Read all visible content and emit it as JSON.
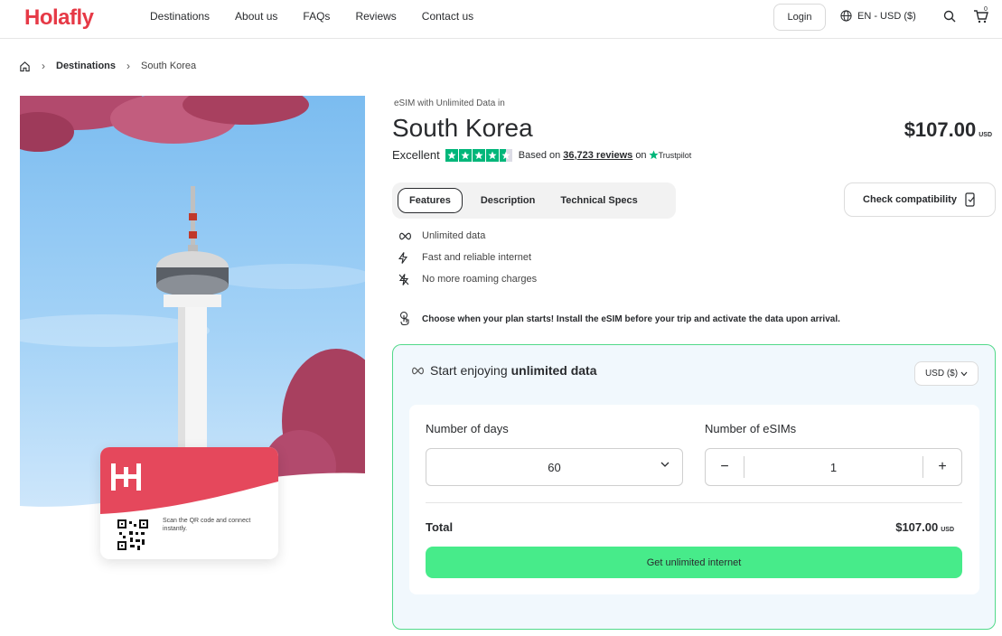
{
  "brand": {
    "logo_text": "Holafly",
    "accent": "#e63946",
    "green": "#47eb8a",
    "trustpilot_green": "#00b67a"
  },
  "nav": {
    "items": [
      "Destinations",
      "About us",
      "FAQs",
      "Reviews",
      "Contact us"
    ]
  },
  "header": {
    "login_label": "Login",
    "language_label": "EN - USD ($)",
    "cart_count": "0"
  },
  "breadcrumb": {
    "destinations": "Destinations",
    "current": "South Korea"
  },
  "hero": {
    "qr_text": "Scan the QR code and connect instantly."
  },
  "product": {
    "subtitle": "eSIM with Unlimited Data in",
    "title": "South Korea",
    "price": "$107.00",
    "price_currency": "USD",
    "rating_word": "Excellent",
    "rating_stars": 4.5,
    "based_on": "Based on",
    "review_count": "36,723 reviews",
    "on": "on",
    "trustpilot": "Trustpilot"
  },
  "tabs": [
    "Features",
    "Description",
    "Technical Specs"
  ],
  "check_compat_label": "Check compatibility",
  "features": [
    {
      "icon": "infinity-icon",
      "text": "Unlimited data"
    },
    {
      "icon": "lightning-icon",
      "text": "Fast and reliable internet"
    },
    {
      "icon": "no-roaming-icon",
      "text": "No more roaming charges"
    }
  ],
  "info_line": "Choose when your plan starts! Install the eSIM before your trip and activate the data upon arrival.",
  "plan": {
    "heading_prefix": "Start enjoying",
    "heading_bold": "unlimited data",
    "currency_select": "USD ($)",
    "days_label": "Number of days",
    "days_value": "60",
    "esims_label": "Number of eSIMs",
    "esims_value": "1",
    "minus": "−",
    "plus": "+",
    "total_label": "Total",
    "total_value": "$107.00",
    "total_currency": "USD",
    "cta_label": "Get unlimited internet"
  }
}
